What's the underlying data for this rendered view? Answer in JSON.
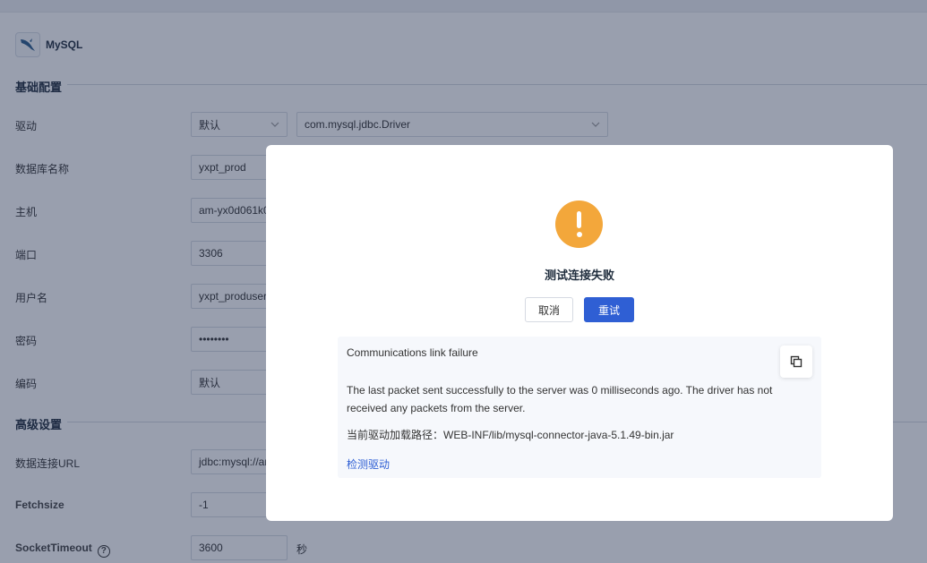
{
  "db": {
    "name": "MySQL",
    "icon": "mysql-dolphin-icon"
  },
  "sections": {
    "basic": "基础配置",
    "advanced": "高级设置"
  },
  "form": {
    "driver": {
      "label": "驱动",
      "type_value": "默认",
      "class_value": "com.mysql.jdbc.Driver"
    },
    "database": {
      "label": "数据库名称",
      "value": "yxpt_prod"
    },
    "host": {
      "label": "主机",
      "value": "am-yx0d061k0"
    },
    "port": {
      "label": "端口",
      "value": "3306"
    },
    "username": {
      "label": "用户名",
      "value": "yxpt_produser"
    },
    "password": {
      "label": "密码",
      "value": "••••••••"
    },
    "encoding": {
      "label": "编码",
      "value": "默认"
    },
    "url": {
      "label": "数据连接URL",
      "value": "jdbc:mysql://an"
    },
    "fetchsize": {
      "label": "Fetchsize",
      "value": "-1"
    },
    "socket_timeout": {
      "label": "SocketTimeout",
      "value": "3600",
      "unit": "秒"
    }
  },
  "dialog": {
    "icon": "warning-icon",
    "title": "测试连接失败",
    "cancel_label": "取消",
    "retry_label": "重试",
    "error_title": "Communications link failure",
    "error_detail": "The last packet sent successfully to the server was 0 milliseconds ago. The driver has not received any packets from the server.",
    "driver_path": "当前驱动加载路径：WEB-INF/lib/mysql-connector-java-5.1.49-bin.jar",
    "detect_label": "检测驱动",
    "copy_icon": "copy-icon"
  },
  "colors": {
    "primary": "#2f5fd4",
    "warning": "#f3a73b",
    "overlay": "rgba(28,42,76,0.45)"
  }
}
